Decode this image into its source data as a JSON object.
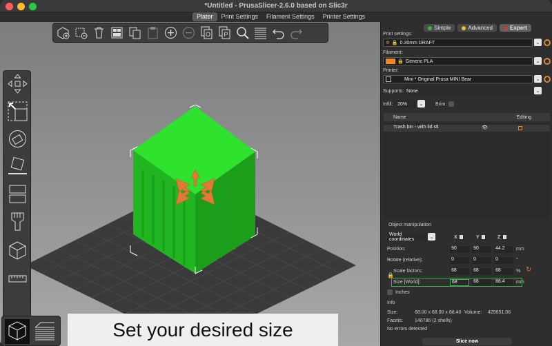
{
  "window": {
    "title": "*Untitled - PrusaSlicer-2.6.0 based on Slic3r"
  },
  "tabs": [
    "Plater",
    "Print Settings",
    "Filament Settings",
    "Printer Settings"
  ],
  "modes": [
    {
      "label": "Simple",
      "color": "#3eb33e"
    },
    {
      "label": "Advanced",
      "color": "#e0c23a"
    },
    {
      "label": "Expert",
      "color": "#d03a3a"
    }
  ],
  "print_settings": {
    "label": "Print settings:",
    "value": "0.30mm DRAFT"
  },
  "filament": {
    "label": "Filament:",
    "value": "Generic PLA",
    "color": "#f08a1e"
  },
  "printer": {
    "label": "Printer:",
    "value": "Mini * Original Prusa MINI Bear"
  },
  "supports": {
    "label": "Supports:",
    "value": "None"
  },
  "infill": {
    "label": "Infill:",
    "value": "20%"
  },
  "brim": {
    "label": "Brim:"
  },
  "objects": {
    "col_name": "Name",
    "col_editing": "Editing",
    "items": [
      {
        "name": "Trash bin - with lid.stl"
      }
    ]
  },
  "manipulation": {
    "title": "Object manipulation",
    "coords": "World coordinates",
    "axes": [
      "X",
      "Y",
      "Z"
    ],
    "position": {
      "label": "Position:",
      "values": [
        "90",
        "90",
        "44.2"
      ],
      "unit": "mm"
    },
    "rotate": {
      "label": "Rotate (relative):",
      "values": [
        "0",
        "0",
        "0"
      ],
      "unit": "°"
    },
    "scale": {
      "label": "Scale factors:",
      "values": [
        "68",
        "68",
        "68"
      ],
      "unit": "%"
    },
    "size": {
      "label": "Size [World]:",
      "values": [
        "68",
        "68",
        "88.4"
      ],
      "unit": "mm"
    },
    "inches": "Inches"
  },
  "info": {
    "title": "Info",
    "size_label": "Size:",
    "size_value": "68.00 x 68.00 x 88.40",
    "volume_label": "Volume:",
    "volume_value": "429651.06",
    "facets_label": "Facets:",
    "facets_value": "140786 (2 shells)",
    "errors": "No errors detected"
  },
  "slice_button": "Slice now",
  "caption": "Set your desired size",
  "icons": [
    "add-icon",
    "delete-icon",
    "delete-all-icon",
    "arrange-icon",
    "copy-icon",
    "paste-icon",
    "add-instance-icon",
    "remove-instance-icon",
    "split-objects-icon",
    "split-parts-icon",
    "search-icon",
    "layers-icon",
    "undo-icon",
    "redo-icon"
  ]
}
